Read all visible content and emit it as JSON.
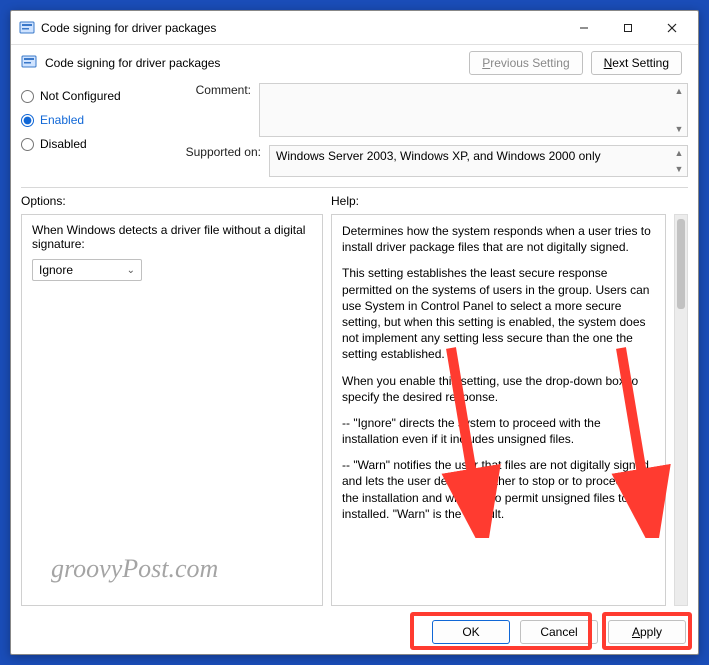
{
  "titlebar": {
    "title": "Code signing for driver packages"
  },
  "header": {
    "title": "Code signing for driver packages",
    "prev_label": "Previous Setting",
    "next_label": "Next Setting"
  },
  "radios": {
    "not_configured": "Not Configured",
    "enabled": "Enabled",
    "disabled": "Disabled",
    "selected": "Enabled"
  },
  "fields": {
    "comment_label": "Comment:",
    "comment_value": "",
    "supported_label": "Supported on:",
    "supported_value": "Windows Server 2003, Windows XP, and Windows 2000 only"
  },
  "section_labels": {
    "options": "Options:",
    "help": "Help:"
  },
  "options": {
    "description": "When Windows detects a driver file without a digital signature:",
    "dropdown_value": "Ignore"
  },
  "help": {
    "p1": "Determines how the system responds when a user tries to install driver package files that are not digitally signed.",
    "p2": "This setting establishes the least secure response permitted on the systems of users in the group. Users can use System in Control Panel to select a more secure setting, but when this setting is enabled, the system does not implement any setting less secure than the one the setting established.",
    "p3": "When you enable this setting, use the drop-down box to specify the desired response.",
    "p4": "--   \"Ignore\" directs the system to proceed with the installation even if it includes unsigned files.",
    "p5": "--   \"Warn\" notifies the user that files are not digitally signed and lets the user decide whether to stop or to proceed with the installation and whether to permit unsigned files to be installed. \"Warn\" is the default."
  },
  "footer": {
    "ok": "OK",
    "cancel": "Cancel",
    "apply": "Apply"
  },
  "watermark": "groovyPost.com"
}
